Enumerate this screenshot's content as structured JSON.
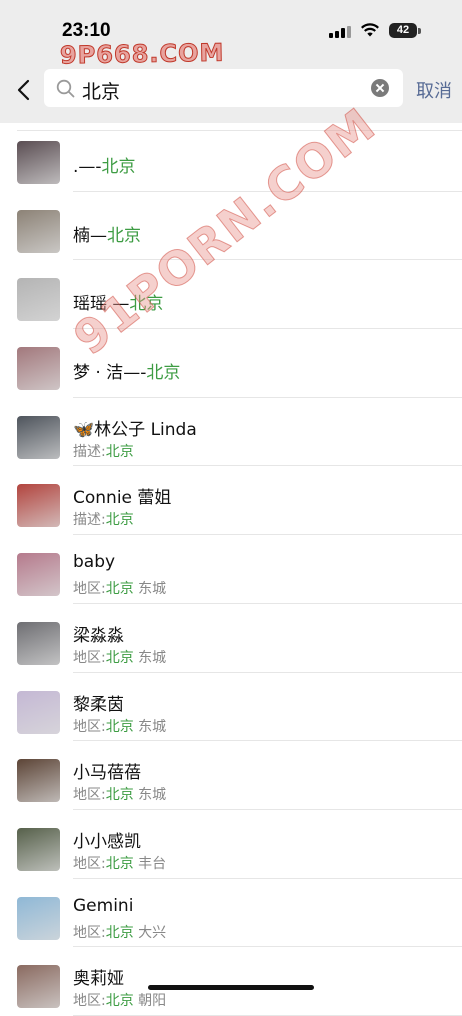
{
  "status_bar": {
    "time": "23:10",
    "battery": "42"
  },
  "watermarks": {
    "top": "9P668.COM",
    "diagonal": "91PORN.COM"
  },
  "search": {
    "query": "北京",
    "cancel_label": "取消"
  },
  "results": [
    {
      "name_prefix": ".—-",
      "name_hl": "北京",
      "name_suffix": "",
      "sub_label": "",
      "sub_hl": "",
      "sub_suffix": "",
      "avatar_color": "#5a4d52"
    },
    {
      "name_prefix": "楠—",
      "name_hl": "北京",
      "name_suffix": "",
      "sub_label": "",
      "sub_hl": "",
      "sub_suffix": "",
      "avatar_color": "#8c8276"
    },
    {
      "name_prefix": "瑶瑶 —",
      "name_hl": "北京",
      "name_suffix": "",
      "sub_label": "",
      "sub_hl": "",
      "sub_suffix": "",
      "avatar_color": "#b4b4b4"
    },
    {
      "name_prefix": "梦 · 洁—-",
      "name_hl": "北京",
      "name_suffix": "",
      "sub_label": "",
      "sub_hl": "",
      "sub_suffix": "",
      "avatar_color": "#a2787c"
    },
    {
      "name_prefix": "🦋林公子 Linda",
      "name_hl": "",
      "name_suffix": "",
      "sub_label": "描述:",
      "sub_hl": "北京",
      "sub_suffix": "",
      "avatar_color": "#4e545c"
    },
    {
      "name_prefix": "Connie 蕾姐",
      "name_hl": "",
      "name_suffix": "",
      "sub_label": "描述:",
      "sub_hl": "北京",
      "sub_suffix": "",
      "avatar_color": "#b2443e"
    },
    {
      "name_prefix": "baby",
      "name_hl": "",
      "name_suffix": "",
      "sub_label": "地区:",
      "sub_hl": "北京",
      "sub_suffix": " 东城",
      "avatar_color": "#b57a8c"
    },
    {
      "name_prefix": "梁淼淼",
      "name_hl": "",
      "name_suffix": "",
      "sub_label": "地区:",
      "sub_hl": "北京",
      "sub_suffix": " 东城",
      "avatar_color": "#6e6e72"
    },
    {
      "name_prefix": "黎柔茵",
      "name_hl": "",
      "name_suffix": "",
      "sub_label": "地区:",
      "sub_hl": "北京",
      "sub_suffix": " 东城",
      "avatar_color": "#c4b8d4"
    },
    {
      "name_prefix": "小马蓓蓓",
      "name_hl": "",
      "name_suffix": "",
      "sub_label": "地区:",
      "sub_hl": "北京",
      "sub_suffix": " 东城",
      "avatar_color": "#5c4436"
    },
    {
      "name_prefix": "小小感凯",
      "name_hl": "",
      "name_suffix": "",
      "sub_label": "地区:",
      "sub_hl": "北京",
      "sub_suffix": " 丰台",
      "avatar_color": "#56604a"
    },
    {
      "name_prefix": "Gemini",
      "name_hl": "",
      "name_suffix": "",
      "sub_label": "地区:",
      "sub_hl": "北京",
      "sub_suffix": " 大兴",
      "avatar_color": "#8fb8d6"
    },
    {
      "name_prefix": "奥莉娅",
      "name_hl": "",
      "name_suffix": "",
      "sub_label": "地区:",
      "sub_hl": "北京",
      "sub_suffix": " 朝阳",
      "avatar_color": "#8a6a60"
    }
  ]
}
